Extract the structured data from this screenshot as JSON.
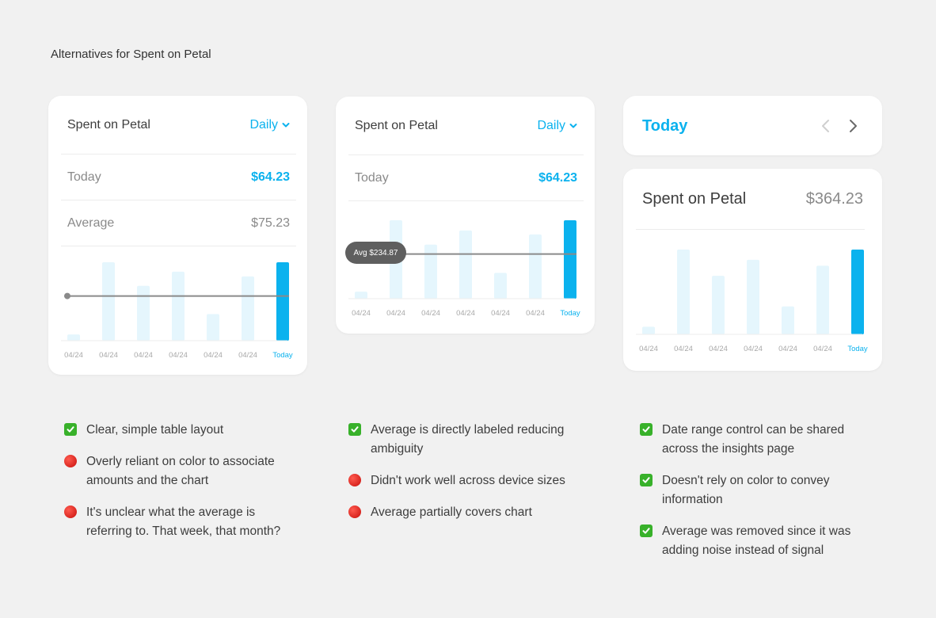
{
  "page_title": "Alternatives for Spent on Petal",
  "card1": {
    "title": "Spent on Petal",
    "period": "Daily",
    "today_label": "Today",
    "today_value": "$64.23",
    "average_label": "Average",
    "average_value": "$75.23"
  },
  "card2": {
    "title": "Spent on Petal",
    "period": "Daily",
    "today_label": "Today",
    "today_value": "$64.23",
    "avg_label": "Avg $234.87"
  },
  "card3": {
    "nav_label": "Today",
    "title": "Spent on Petal",
    "value": "$364.23"
  },
  "colors": {
    "accent": "#0bb2ee",
    "bar_light": "#e5f6fd",
    "avg_line": "#8a8a8a"
  },
  "chart_data": [
    {
      "type": "bar",
      "categories": [
        "04/24",
        "04/24",
        "04/24",
        "04/24",
        "04/24",
        "04/24",
        "Today"
      ],
      "values": [
        8,
        100,
        70,
        88,
        34,
        82,
        100
      ],
      "highlight_index": 6,
      "average_line": 57,
      "ylim": [
        0,
        100
      ],
      "grid": false
    },
    {
      "type": "bar",
      "categories": [
        "04/24",
        "04/24",
        "04/24",
        "04/24",
        "04/24",
        "04/24",
        "Today"
      ],
      "values": [
        9,
        100,
        69,
        87,
        33,
        82,
        100
      ],
      "highlight_index": 6,
      "average_line": 57,
      "average_label": "Avg $234.87",
      "ylim": [
        0,
        100
      ],
      "grid": false
    },
    {
      "type": "bar",
      "categories": [
        "04/24",
        "04/24",
        "04/24",
        "04/24",
        "04/24",
        "04/24",
        "Today"
      ],
      "values": [
        9,
        100,
        69,
        88,
        33,
        81,
        100
      ],
      "highlight_index": 6,
      "ylim": [
        0,
        100
      ],
      "grid": false
    }
  ],
  "notes": [
    {
      "items": [
        {
          "icon": "check-icon",
          "text_lines": [
            "Clear, simple table layout"
          ]
        },
        {
          "icon": "red-circle-icon",
          "text_lines": [
            "Overly reliant on color to associate",
            "amounts and the chart"
          ]
        },
        {
          "icon": "red-circle-icon",
          "text_lines": [
            "It's unclear what the average is",
            "referring to. That week, that month?"
          ]
        }
      ]
    },
    {
      "items": [
        {
          "icon": "check-icon",
          "text_lines": [
            "Average is directly labeled reducing",
            "ambiguity"
          ]
        },
        {
          "icon": "red-circle-icon",
          "text_lines": [
            "Didn't work well across device sizes"
          ]
        },
        {
          "icon": "red-circle-icon",
          "text_lines": [
            "Average partially covers chart"
          ]
        }
      ]
    },
    {
      "items": [
        {
          "icon": "check-icon",
          "text_lines": [
            "Date range control can be shared",
            "across the insights page"
          ]
        },
        {
          "icon": "check-icon",
          "text_lines": [
            "Doesn't rely on color to convey",
            "information"
          ]
        },
        {
          "icon": "check-icon",
          "text_lines": [
            "Average was removed since it was",
            "adding noise instead of signal"
          ]
        }
      ]
    }
  ]
}
